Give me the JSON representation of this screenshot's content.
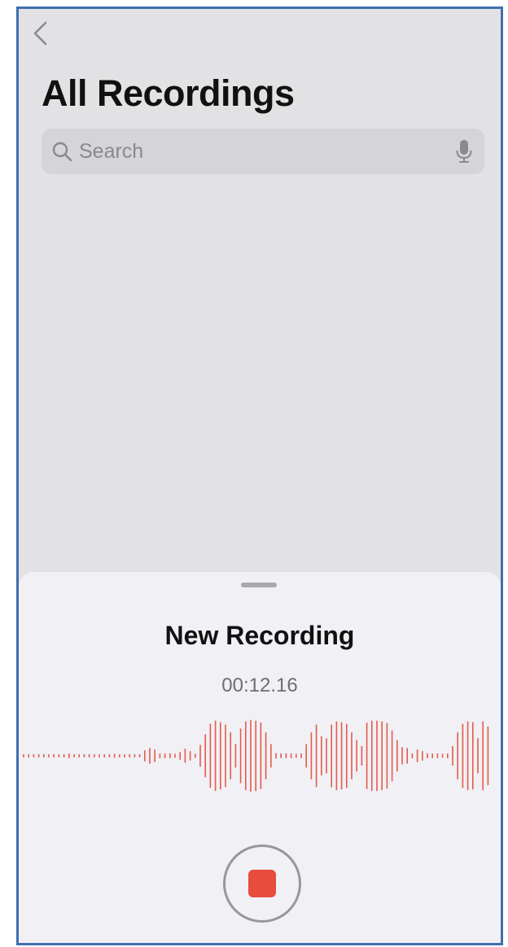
{
  "colors": {
    "accent": "#e74c3c",
    "waveform": "#e25c4b",
    "icon_gray": "#8a8a8e"
  },
  "header": {
    "back_icon": "chevron-left-icon",
    "title": "All Recordings"
  },
  "search": {
    "placeholder": "Search",
    "value": "",
    "search_icon": "magnifying-glass-icon",
    "mic_icon": "microphone-icon"
  },
  "recording": {
    "title": "New Recording",
    "elapsed": "00:12.16",
    "stop_icon": "stop-square-icon",
    "waveform_levels": [
      0.04,
      0.04,
      0.04,
      0.04,
      0.04,
      0.04,
      0.04,
      0.04,
      0.04,
      0.06,
      0.04,
      0.04,
      0.04,
      0.04,
      0.04,
      0.04,
      0.04,
      0.04,
      0.05,
      0.04,
      0.04,
      0.04,
      0.04,
      0.04,
      0.14,
      0.2,
      0.16,
      0.06,
      0.06,
      0.06,
      0.05,
      0.1,
      0.18,
      0.12,
      0.05,
      0.28,
      0.55,
      0.82,
      0.9,
      0.86,
      0.8,
      0.6,
      0.3,
      0.7,
      0.88,
      0.92,
      0.9,
      0.85,
      0.6,
      0.3,
      0.07,
      0.06,
      0.06,
      0.06,
      0.05,
      0.06,
      0.3,
      0.6,
      0.8,
      0.5,
      0.45,
      0.8,
      0.88,
      0.86,
      0.82,
      0.6,
      0.4,
      0.25,
      0.85,
      0.9,
      0.9,
      0.88,
      0.84,
      0.65,
      0.4,
      0.22,
      0.2,
      0.06,
      0.16,
      0.12,
      0.06,
      0.06,
      0.06,
      0.05,
      0.06,
      0.25,
      0.6,
      0.82,
      0.88,
      0.86,
      0.45,
      0.88,
      0.75
    ]
  }
}
